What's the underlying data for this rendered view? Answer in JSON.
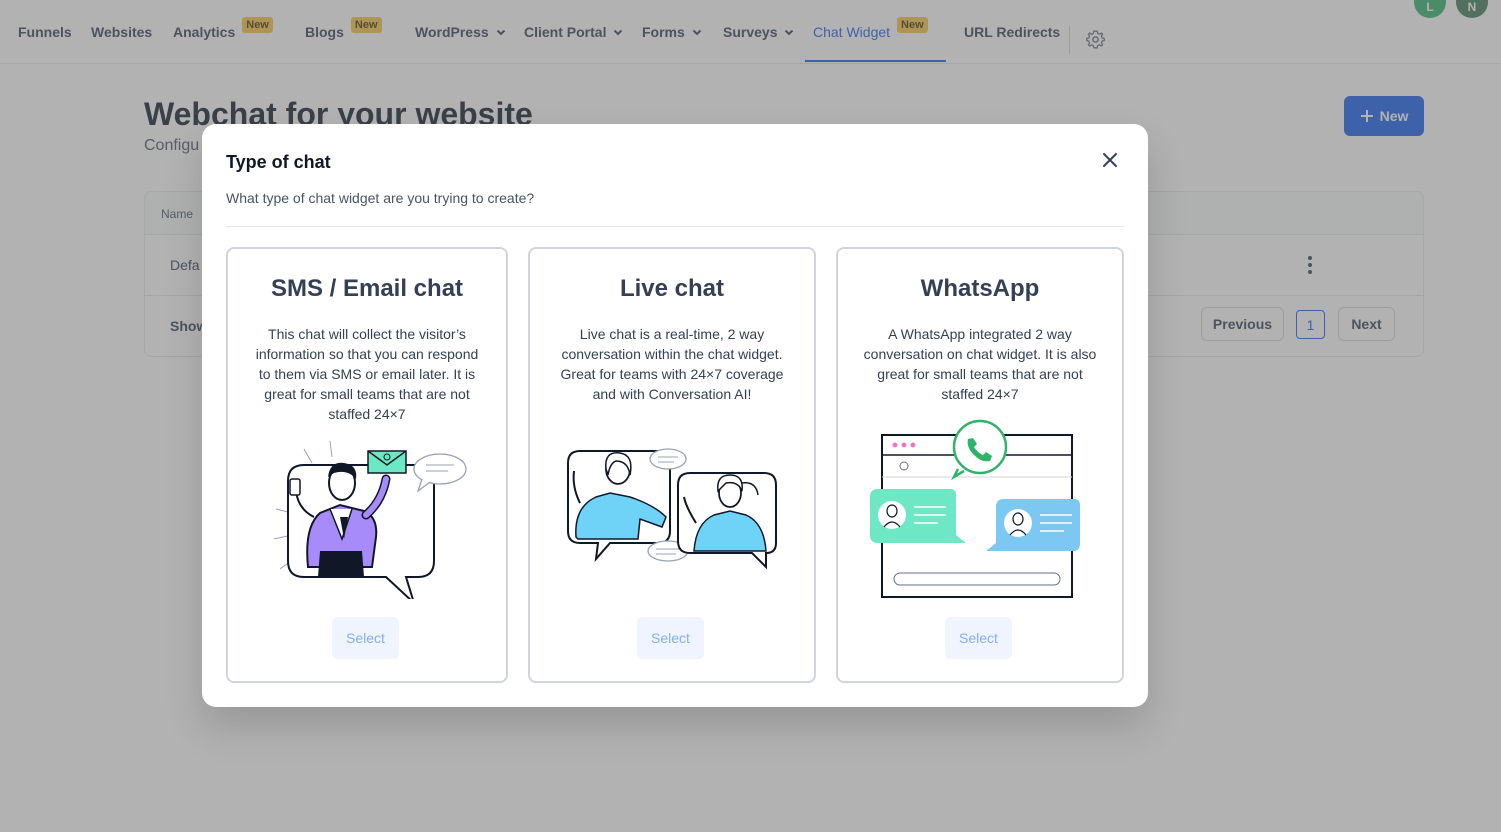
{
  "nav": {
    "items": [
      {
        "label": "Funnels"
      },
      {
        "label": "Websites"
      },
      {
        "label": "Analytics",
        "badge": "New"
      },
      {
        "label": "Blogs",
        "badge": "New"
      },
      {
        "label": "WordPress"
      },
      {
        "label": "Client Portal"
      },
      {
        "label": "Forms"
      },
      {
        "label": "Surveys"
      },
      {
        "label": "Chat Widget",
        "badge": "New",
        "active": true
      },
      {
        "label": "URL Redirects"
      }
    ],
    "avatars": [
      "L",
      "N"
    ]
  },
  "page": {
    "title": "Webchat for your website",
    "subtitle": "Configu",
    "new_button": "New",
    "table": {
      "header_name": "Name",
      "row_name": "Defa",
      "footer_text": "Show",
      "previous": "Previous",
      "page": "1",
      "next": "Next"
    }
  },
  "modal": {
    "title": "Type of chat",
    "subtitle": "What type of chat widget are you trying to create?",
    "options": [
      {
        "title": "SMS / Email chat",
        "description": "This chat will collect the visitor’s information so that you can respond to them via SMS or email later. It is great for small teams that are not staffed 24×7",
        "select": "Select"
      },
      {
        "title": "Live chat",
        "description": "Live chat is a real-time, 2 way conversation within the chat widget. Great for teams with 24×7 coverage and with Conversation AI!",
        "select": "Select"
      },
      {
        "title": "WhatsApp",
        "description": "A WhatsApp integrated 2 way conversation on chat widget. It is also great for small teams that are not staffed 24×7",
        "select": "Select"
      }
    ]
  },
  "colors": {
    "primary": "#155eef",
    "badge": "#f6c544",
    "select_bg": "#eff4ff",
    "select_text": "#84adff",
    "purple": "#a78bfa",
    "light_blue": "#6ed3f7",
    "mint": "#6ee7c5",
    "whatsapp_green": "#2fb36b"
  }
}
